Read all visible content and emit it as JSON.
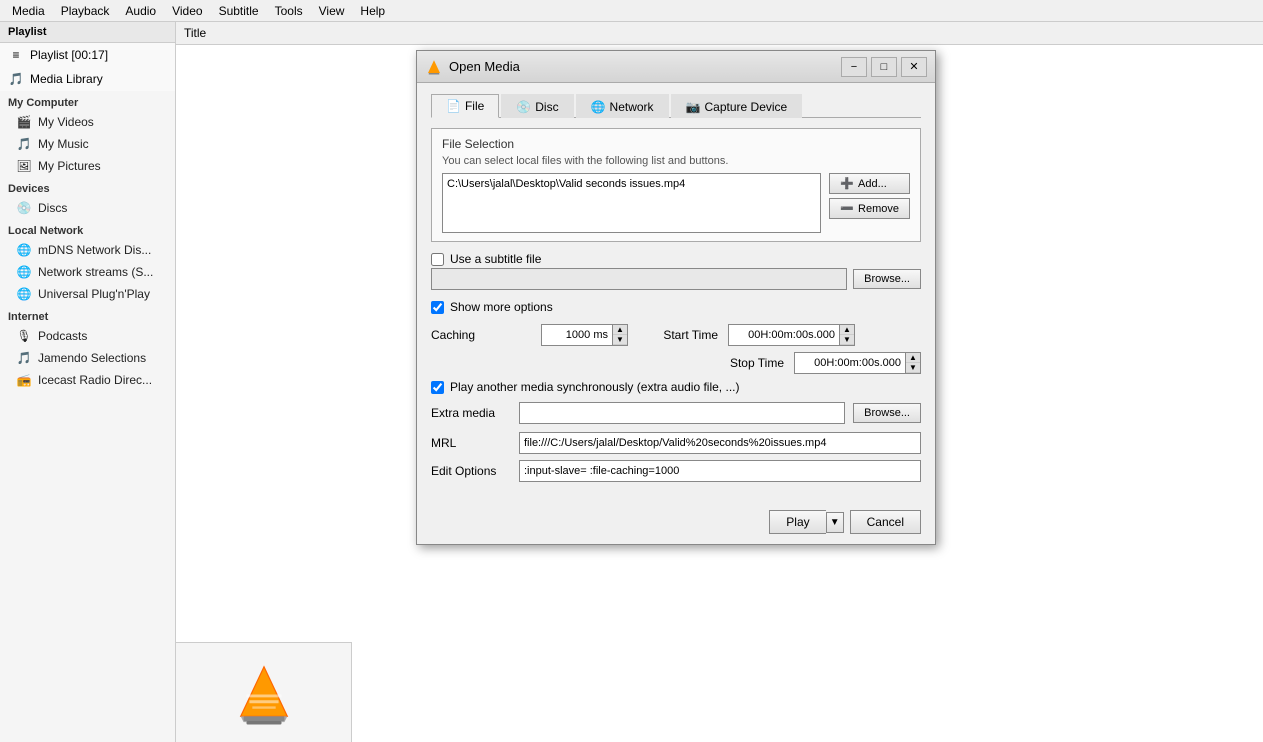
{
  "menubar": {
    "items": [
      "Media",
      "Playback",
      "Audio",
      "Video",
      "Subtitle",
      "Tools",
      "View",
      "Help"
    ]
  },
  "sidebar": {
    "playlist_section": "Playlist",
    "playlist_item": "Playlist [00:17]",
    "media_library": "Media Library",
    "my_computer_section": "My Computer",
    "my_videos": "My Videos",
    "my_music": "My Music",
    "my_pictures": "My Pictures",
    "devices_section": "Devices",
    "discs": "Discs",
    "local_network_section": "Local Network",
    "mdns": "mDNS Network Dis...",
    "network_streams": "Network streams (S...",
    "universal_plug": "Universal Plug'n'Play",
    "internet_section": "Internet",
    "podcasts": "Podcasts",
    "jamendo": "Jamendo Selections",
    "icecast": "Icecast Radio Direc..."
  },
  "content": {
    "title_col": "Title",
    "title_icon": "🎵"
  },
  "dialog": {
    "title": "Open Media",
    "tabs": [
      "File",
      "Disc",
      "Network",
      "Capture Device"
    ],
    "tab_active": "File",
    "file_selection_label": "File Selection",
    "file_selection_desc": "You can select local files with the following list and buttons.",
    "file_path": "C:\\Users\\jalal\\Desktop\\Valid seconds issues.mp4",
    "add_button": "Add...",
    "remove_button": "Remove",
    "subtitle_checkbox_label": "Use a subtitle file",
    "subtitle_checked": false,
    "subtitle_browse": "Browse...",
    "show_more_label": "Show more options",
    "show_more_checked": true,
    "caching_label": "Caching",
    "caching_value": "1000 ms",
    "start_time_label": "Start Time",
    "start_time_value": "00H:00m:00s.000",
    "stop_time_label": "Stop Time",
    "stop_time_value": "00H:00m:00s.000",
    "sync_label": "Play another media synchronously (extra audio file, ...)",
    "sync_checked": true,
    "extra_media_label": "Extra media",
    "extra_media_value": "",
    "extra_browse": "Browse...",
    "mrl_label": "MRL",
    "mrl_value": "file:///C:/Users/jalal/Desktop/Valid%20seconds%20issues.mp4",
    "edit_options_label": "Edit Options",
    "edit_options_value": ":input-slave= :file-caching=1000",
    "play_button": "Play",
    "cancel_button": "Cancel"
  }
}
